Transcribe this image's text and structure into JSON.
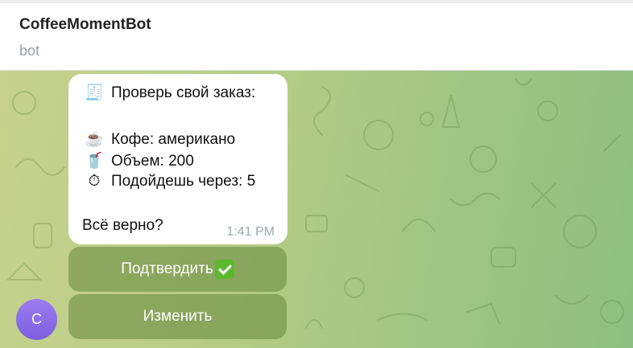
{
  "header": {
    "title": "CoffeeMomentBot",
    "subtitle": "bot"
  },
  "message": {
    "title_icon": "receipt-icon",
    "title": "Проверь свой заказ:",
    "lines": [
      {
        "icon": "coffee-cup-icon",
        "text": "Кофе: американо"
      },
      {
        "icon": "cup-with-straw-icon",
        "text": "Объем: 200"
      },
      {
        "icon": "stopwatch-icon",
        "text": "Подойдешь через: 5"
      }
    ],
    "question": "Всё верно?",
    "time": "1:41 PM"
  },
  "keyboard": {
    "confirm_label": "Подтвердить",
    "confirm_icon": "checkmark-icon",
    "edit_label": "Изменить"
  },
  "sender": {
    "avatar_letter": "C",
    "avatar_color": "#8a6ae8"
  },
  "colors": {
    "background_start": "#c7d28d",
    "background_end": "#8dbf80",
    "confirm_check": "#5cb82e"
  }
}
